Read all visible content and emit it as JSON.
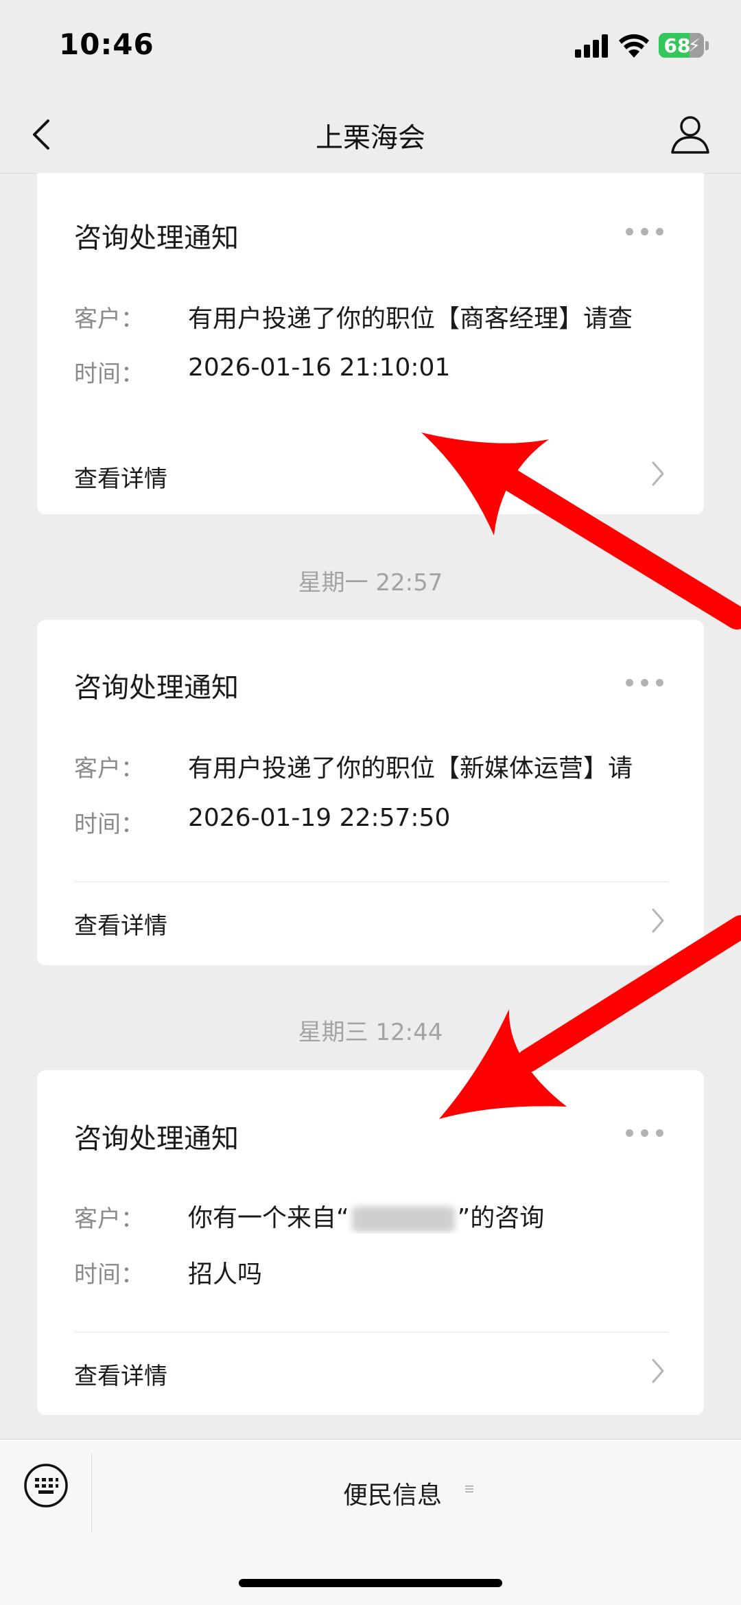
{
  "status_bar": {
    "time": "10:46",
    "battery": "68"
  },
  "nav": {
    "title": "上栗海会"
  },
  "feed": [
    {
      "title": "咨询处理通知",
      "customer_label": "客户：",
      "customer_value": "有用户投递了你的职位【商客经理】请查",
      "time_label": "时间：",
      "time_value": "2026-01-16 21:10:01",
      "link_label": "查看详情"
    },
    {
      "timestamp": "星期一 22:57",
      "title": "咨询处理通知",
      "customer_label": "客户：",
      "customer_value": "有用户投递了你的职位【新媒体运营】请",
      "time_label": "时间：",
      "time_value": "2026-01-19 22:57:50",
      "link_label": "查看详情"
    },
    {
      "timestamp": "星期三 12:44",
      "title": "咨询处理通知",
      "customer_label": "客户：",
      "customer_prefix": "你有一个来自“",
      "customer_suffix": "”的咨询",
      "time_label": "时间：",
      "time_value": "招人吗",
      "link_label": "查看详情"
    }
  ],
  "bottom_menu": {
    "item_label": "便民信息"
  },
  "colors": {
    "annotation_arrow": "#ff0000",
    "battery_green": "#34c759"
  }
}
